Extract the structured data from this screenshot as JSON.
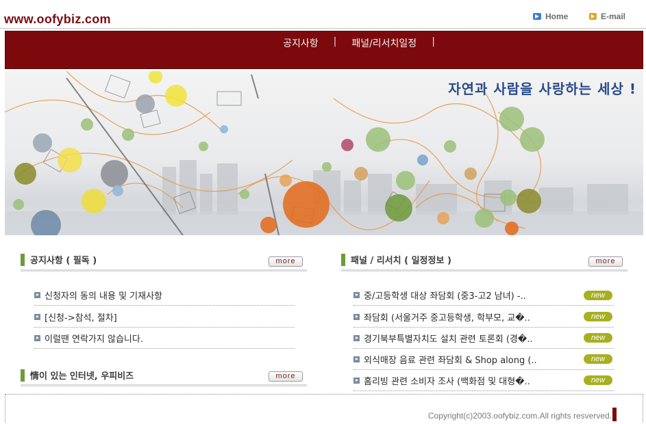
{
  "header": {
    "logo": "www.oofybiz.com",
    "home_label": "Home",
    "email_label": "E-mail"
  },
  "nav": {
    "items": [
      "공지사항",
      "패널/리서치일정"
    ],
    "separator": "|"
  },
  "banner": {
    "slogan": "자연과 사람을 사랑하는 세상 !"
  },
  "notice": {
    "title": "공지사항 ( 필독 )",
    "more": "more",
    "items": [
      "신청자의 동의 내용 및 기재사항",
      "[신청->참석, 절차]",
      "이럴땐 연락가지 않습니다."
    ]
  },
  "info": {
    "title": "情이 있는 인터넷, 우피비즈",
    "more": "more"
  },
  "panel": {
    "title": "패널 / 리서치 ( 일정정보 )",
    "more": "more",
    "new_label": "new",
    "items": [
      "중/고등학생 대상 좌담회 (중3-고2 남녀) -..",
      "좌담회 (서울거주 중고등학생, 학부모, 교�..",
      "경기북부특별자치도 설치 관련 토론회 (경�..",
      "외식매장 음료 관련 좌담회 & Shop along (..",
      "홈리빙 관련 소비자 조사 (백화점 및 대형�.."
    ]
  },
  "footer": {
    "copyright": "Copyright(c)2003.oofybiz.com.All rights resverved."
  },
  "colors": {
    "brand": "#7c0a0d",
    "accent_green": "#6f9a3a",
    "new_badge": "#a6b020",
    "slogan": "#284a8c"
  }
}
